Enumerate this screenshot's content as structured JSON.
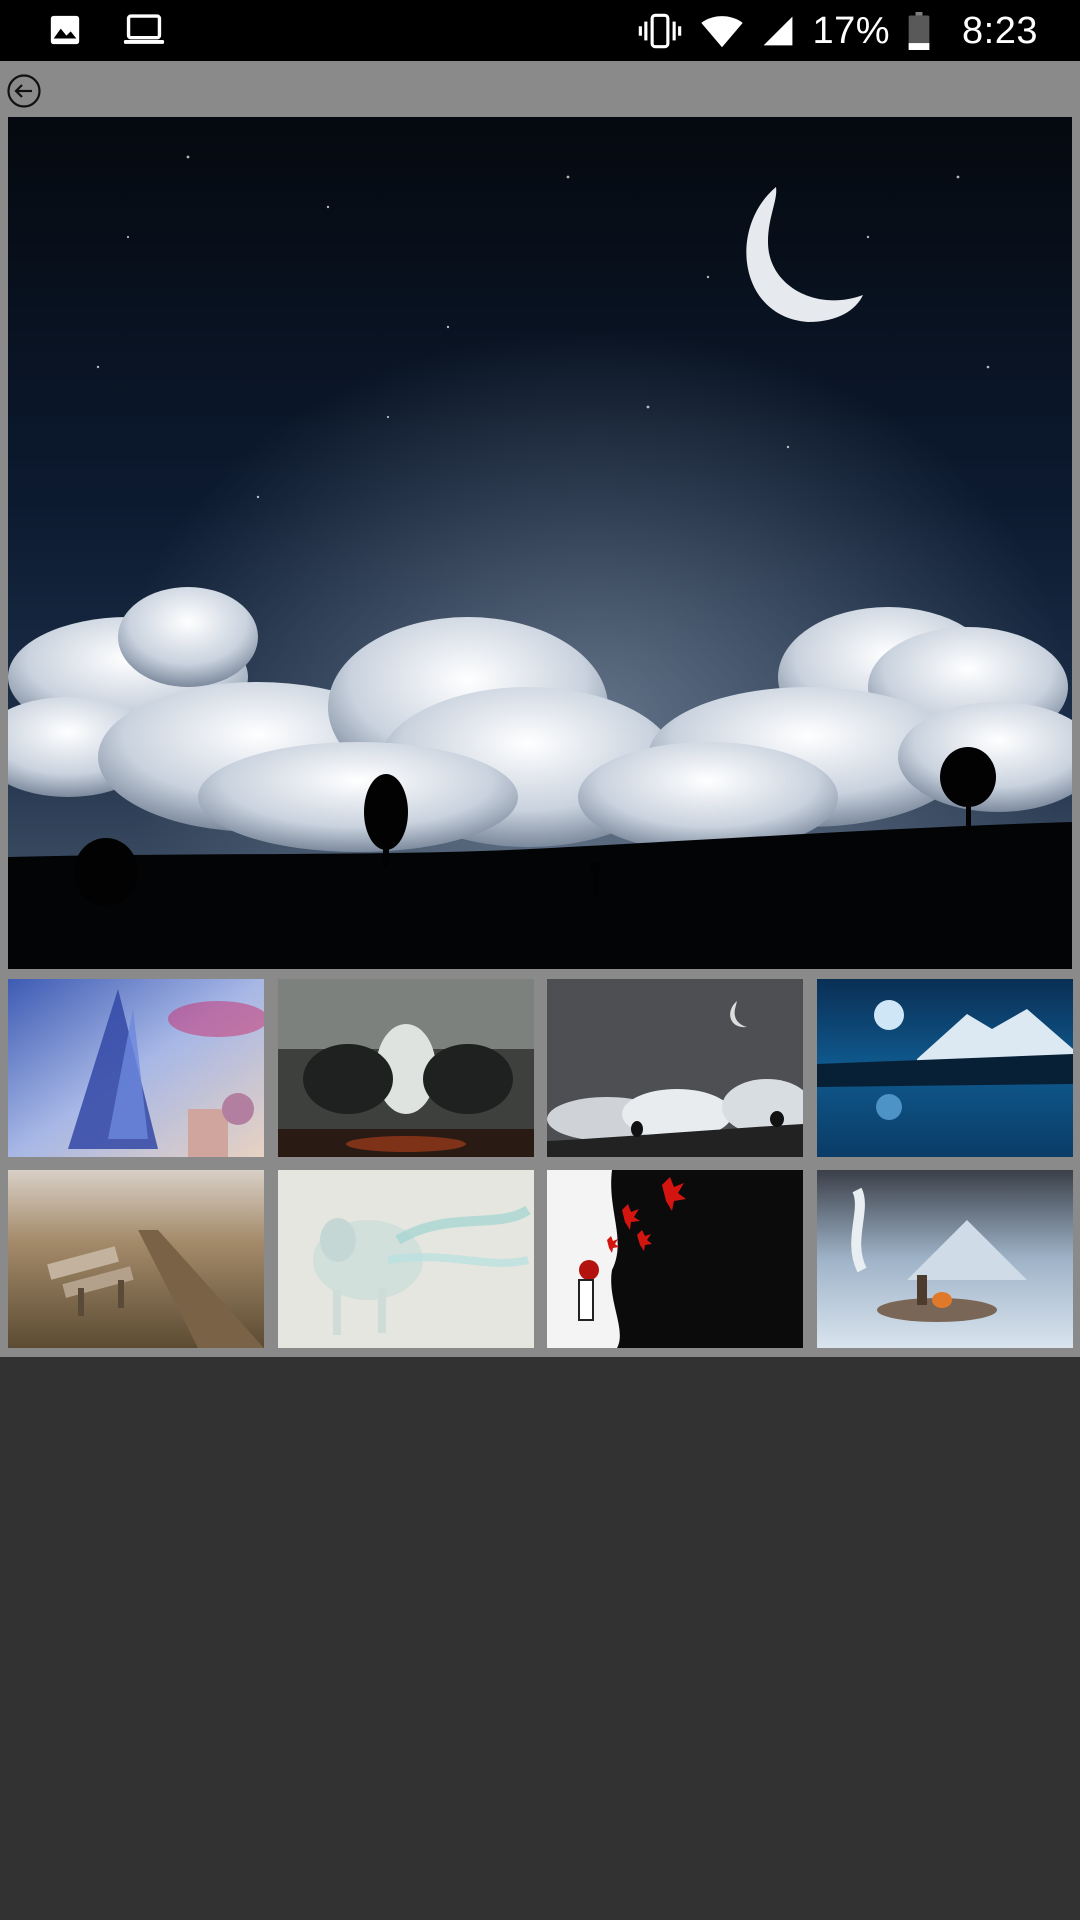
{
  "status_bar": {
    "battery": "17%",
    "time": "8:23",
    "icons": [
      "image-icon",
      "laptop-icon",
      "vibrate-icon",
      "wifi-icon",
      "signal-icon",
      "battery-icon"
    ]
  },
  "toolbar": {
    "back_icon": "back-arrow-circle-icon"
  },
  "gallery": {
    "main_image": "night-sky-crescent-moon-clouds",
    "thumbnails": [
      "fantasy-floating-castle",
      "dark-beasts-warrior",
      "night-sky-crescent-moon-clouds",
      "blue-moon-mountain-lake",
      "autumn-bench-dirt-road",
      "white-spirit-wolf",
      "girl-red-butterflies",
      "snowy-mountain-campfire"
    ]
  },
  "colors": {
    "status_bar": "#000000",
    "toolbar": "#8a8a8a",
    "background": "#323232"
  }
}
